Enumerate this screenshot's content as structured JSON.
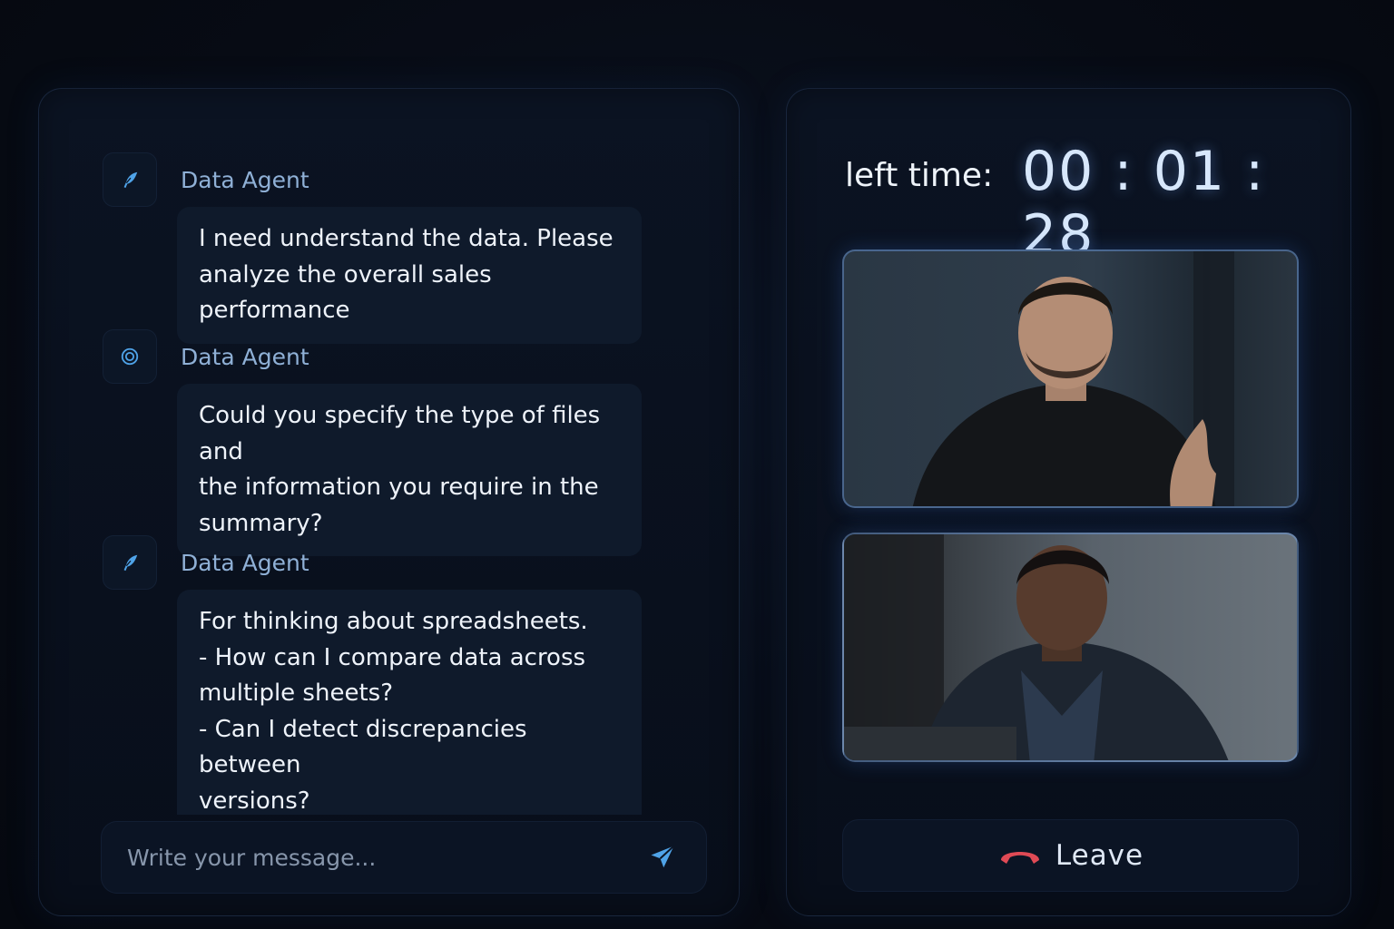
{
  "chat": {
    "messages": [
      {
        "sender": "Data Agent",
        "icon": "quill-icon",
        "text": "I need understand the data. Please\nanalyze the overall sales performance"
      },
      {
        "sender": "Data Agent",
        "icon": "target-icon",
        "text": "Could you specify the type of files and\nthe information you require in the\nsummary?"
      },
      {
        "sender": "Data Agent",
        "icon": "quill-icon",
        "text": "For thinking about spreadsheets.\n- How can I compare data across\nmultiple sheets?\n- Can I detect discrepancies between\nversions?\n- What's the best method to visualize"
      }
    ],
    "composer": {
      "placeholder": "Write your message...",
      "send_icon": "send-icon"
    }
  },
  "call": {
    "timer_label": "left time:",
    "timer_value": "00 : 01 : 28",
    "participants": [
      {
        "video": "participant-video-1"
      },
      {
        "video": "participant-video-2"
      }
    ],
    "leave": {
      "label": "Leave",
      "icon": "hang-up-icon",
      "icon_color": "#e04a55"
    }
  },
  "colors": {
    "background": "#070b14",
    "panel": "#0b1322",
    "accent": "#4fa3e8",
    "bubble": "#0f1a2b"
  }
}
